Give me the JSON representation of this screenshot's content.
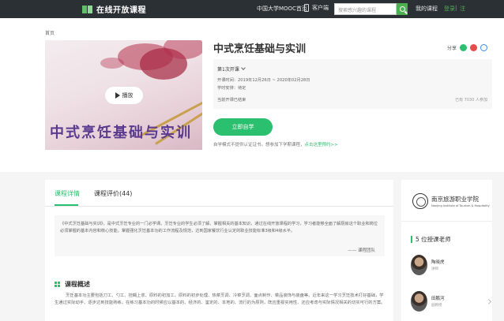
{
  "header": {
    "logo_text": "在线开放课程",
    "nav_mooc": "中国大学MOOC首页",
    "client_label": "客户端",
    "search_placeholder": "搜索感兴趣的课程",
    "my_courses": "我的课程",
    "login": "登录",
    "separator": "|",
    "register": "注"
  },
  "breadcrumb": "首页",
  "course": {
    "cover_title": "中式烹饪基础与实训",
    "play_label": "播放",
    "title": "中式烹饪基础与实训",
    "share_label": "分享",
    "term": "第1次开课",
    "dates": "开课时间：2019年12月26日 ~ 2020年02月28日",
    "hours": "学时安排：待定",
    "status": "当前开课已结束",
    "enrolled": "已有 7030 人参加",
    "join_button": "立即自学",
    "cert_note": "自学模式不提供认证证书。想参加下学期课程，",
    "cert_link": "点击这里预约>>"
  },
  "tabs": [
    "课程详情",
    "课程评价(44)"
  ],
  "quote": {
    "text": "《中式烹饪基础与实训》，是中式烹饪专业的一门必学课。烹饪专业的学生必须了解、掌握相关的基本知识，通过在线开放课程的学习，学习者能够全面了解厨房这个职业和岗位必须掌握的基本内容和核心技能，掌握强化烹饪基本功的工作流程及规范，达到国家餐饮行业认定的职业技能标准3级和4级水平。",
    "sign": "—— 课程团队"
  },
  "overview": {
    "heading": "课程概述",
    "text": "烹饪基本功主要包括刀工、勺工、挂糊上浆、原料的初加工、原料的初步处理、热菜烹调、冷菜烹调、面点制作、菜品装饰与装盘等。近年来这一学习烹饪技术打好基础，学生通过实际动手、逐步达到技能熟练，在练习基本功的时候应以基本的、经济的、鉴定的、本地的、流行的为原则，既应重视实用性、还应考虑与实际情况相关的切实可行的方案。"
  },
  "sidebar": {
    "school_zh": "南京旅游职业学院",
    "school_en": "Nanjing Institute of Tourism & Hospitality",
    "teachers_heading": "5 位授课老师",
    "teachers": [
      {
        "name": "陶晓虎",
        "role": "讲师"
      },
      {
        "name": "田鹏河",
        "role": "副教授"
      }
    ]
  },
  "colors": {
    "accent": "#2bc06f",
    "topbar": "#2b3035",
    "cover_title": "#5a3a8f"
  }
}
